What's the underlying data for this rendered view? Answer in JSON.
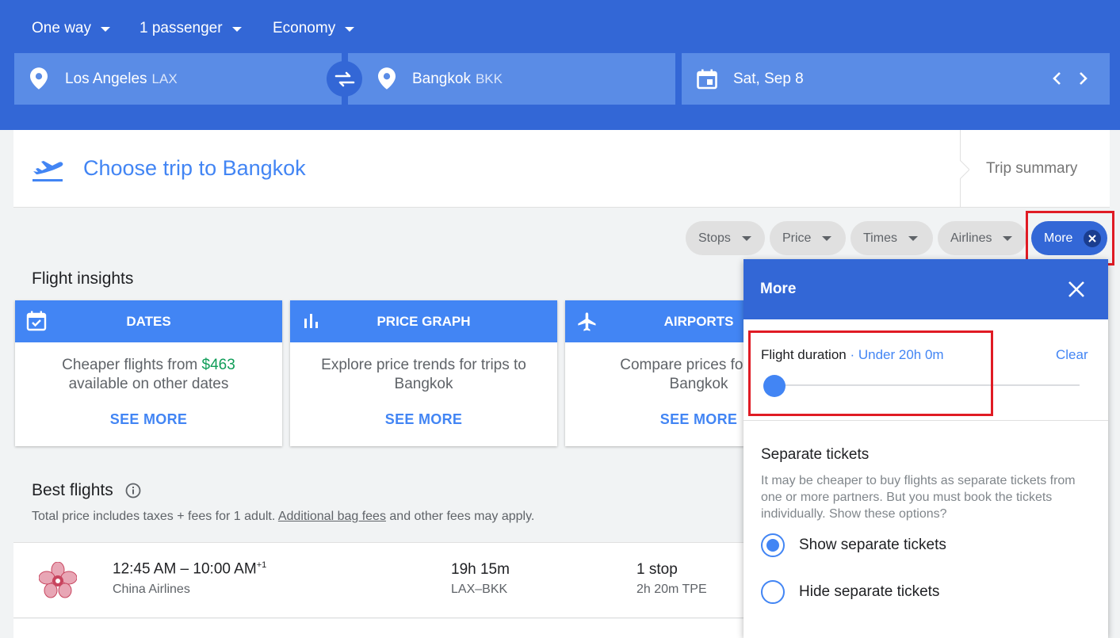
{
  "header": {
    "trip_type": "One way",
    "passengers": "1 passenger",
    "cabin": "Economy",
    "origin": {
      "city": "Los Angeles",
      "code": "LAX"
    },
    "destination": {
      "city": "Bangkok",
      "code": "BKK"
    },
    "date": "Sat, Sep 8"
  },
  "trip": {
    "title": "Choose trip to Bangkok",
    "summary": "Trip summary"
  },
  "filters": {
    "stops": "Stops",
    "price": "Price",
    "times": "Times",
    "airlines": "Airlines",
    "more": "More"
  },
  "insights": {
    "heading": "Flight insights",
    "cards": [
      {
        "title": "DATES",
        "text_before": "Cheaper flights from ",
        "price": "$463",
        "text_after": "available on other dates",
        "link": "SEE MORE"
      },
      {
        "title": "PRICE GRAPH",
        "text": "Explore price trends for trips to Bangkok",
        "link": "SEE MORE"
      },
      {
        "title": "AIRPORTS",
        "text": "Compare prices for airports near Bangkok",
        "line1": "Compare prices for airp",
        "line2": "Bangkok",
        "link": "SEE MORE"
      }
    ]
  },
  "best_flights": {
    "heading": "Best flights",
    "note_before": "Total price includes taxes + fees for 1 adult. ",
    "note_link": "Additional bag fees",
    "note_after": " and other fees may apply.",
    "flights": [
      {
        "times": "12:45 AM – 10:00 AM",
        "day_offset": "+1",
        "airline": "China Airlines",
        "duration": "19h 15m",
        "route": "LAX–BKK",
        "stops": "1 stop",
        "layover": "2h 20m TPE"
      }
    ]
  },
  "more_panel": {
    "title": "More",
    "duration_label": "Flight duration",
    "duration_separator": " · ",
    "duration_value": "Under 20h 0m",
    "clear": "Clear",
    "slider_level": 0,
    "separate_heading": "Separate tickets",
    "separate_desc": "It may be cheaper to buy flights as separate tickets from one or more partners. But you must book the tickets individually. Show these options?",
    "options": [
      {
        "label": "Show separate tickets",
        "selected": true
      },
      {
        "label": "Hide separate tickets",
        "selected": false
      }
    ]
  },
  "colors": {
    "header_bg": "#3367d6",
    "accent": "#4285f4",
    "price_green": "#0f9d58",
    "highlight_red": "#e01b24"
  }
}
